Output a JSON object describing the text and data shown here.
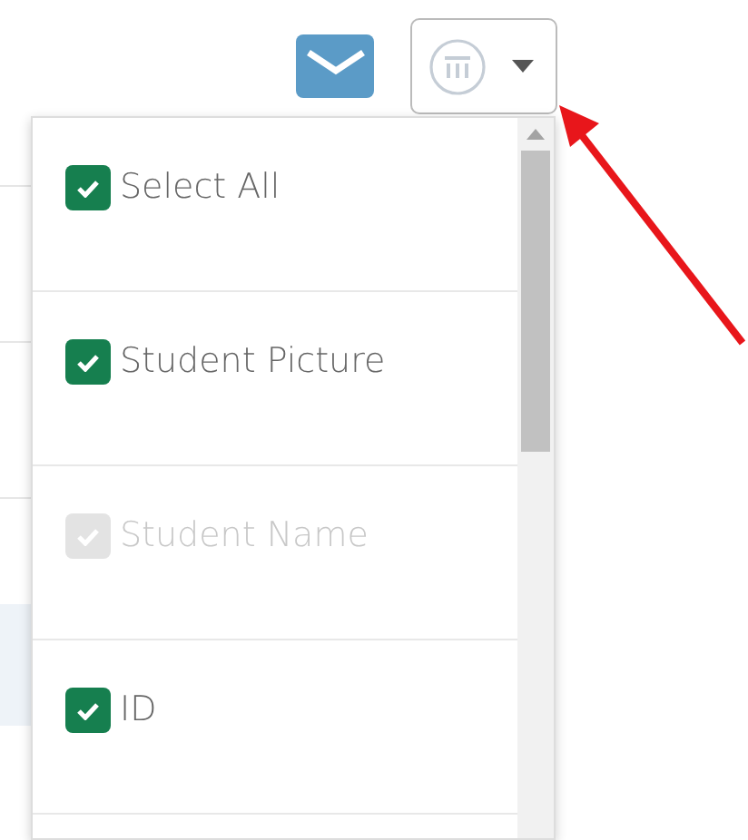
{
  "column_menu": {
    "items": [
      {
        "label": "Select All",
        "checked": true,
        "disabled": false
      },
      {
        "label": "Student Picture",
        "checked": true,
        "disabled": false
      },
      {
        "label": "Student Name",
        "checked": true,
        "disabled": true
      },
      {
        "label": "ID",
        "checked": true,
        "disabled": false
      }
    ]
  }
}
